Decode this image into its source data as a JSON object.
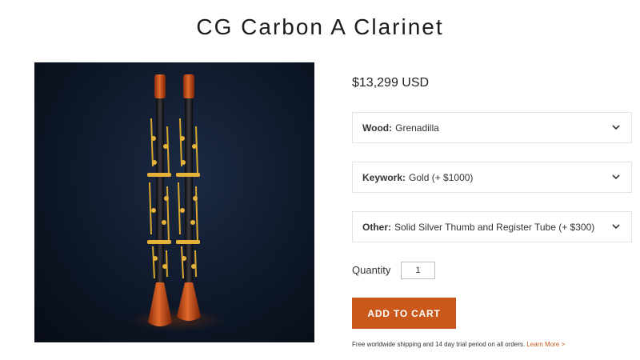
{
  "product": {
    "title": "CG Carbon A Clarinet",
    "price": "$13,299 USD",
    "image_alt": "two carbon clarinets with wooden bells and gold keys"
  },
  "variants": [
    {
      "label": "Wood:",
      "value": "Grenadilla",
      "icon": "chevron-down-icon"
    },
    {
      "label": "Keywork:",
      "value": "Gold (+ $1000)",
      "icon": "chevron-down-icon"
    },
    {
      "label": "Other:",
      "value": "Solid Silver Thumb and Register Tube (+ $300)",
      "icon": "chevron-down-icon"
    }
  ],
  "quantity": {
    "label": "Quantity",
    "value": "1"
  },
  "cart": {
    "button_label": "ADD TO CART"
  },
  "shipping": {
    "text": "Free worldwide shipping and 14 day trial period on all orders.",
    "link": "Learn More >"
  },
  "colors": {
    "accent": "#c9581a",
    "image_bg": "#0e1828"
  }
}
